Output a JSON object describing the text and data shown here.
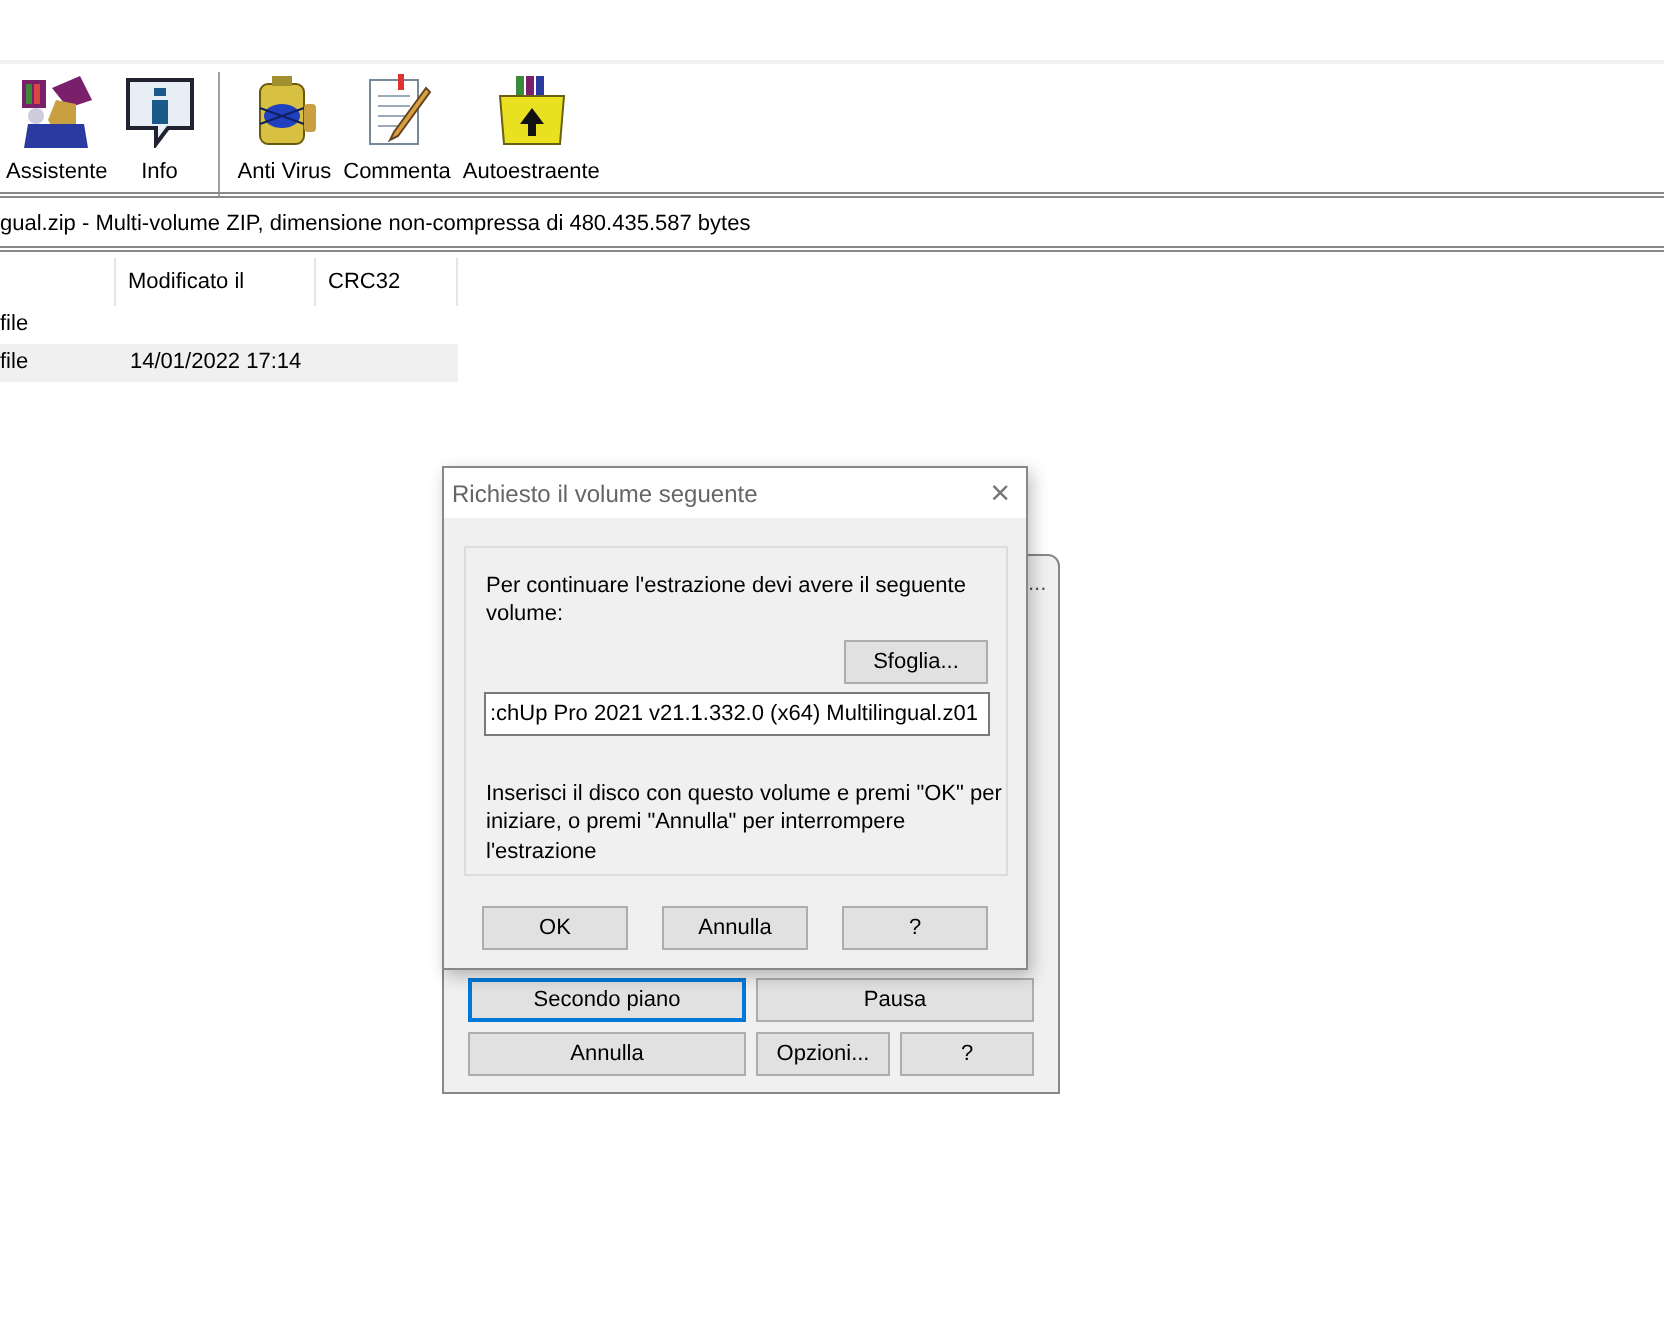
{
  "toolbar": [
    {
      "kind": "button",
      "label": "Assistente"
    },
    {
      "kind": "button",
      "label": "Info"
    },
    {
      "kind": "separator"
    },
    {
      "kind": "button",
      "label": "Anti Virus"
    },
    {
      "kind": "button",
      "label": "Commenta"
    },
    {
      "kind": "button",
      "label": "Autoestraente"
    }
  ],
  "address_bar": {
    "text": "gual.zip - Multi-volume ZIP, dimensione non-compressa di 480.435.587 bytes"
  },
  "file_list": {
    "columns": [
      "Modificato il",
      "CRC32"
    ],
    "rows": [
      {
        "name": "file",
        "selected": false
      },
      {
        "name": "file",
        "modified": "14/01/2022 17:14",
        "selected": true
      }
    ]
  },
  "back_dialog": {
    "title": "...",
    "buttons": [
      {
        "label": "Secondo piano",
        "focused": true
      },
      {
        "label": "Pausa",
        "focused": false
      },
      {
        "label": "Annulla",
        "focused": false
      },
      {
        "label": "Opzioni...",
        "focused": false
      },
      {
        "label": "?",
        "focused": false
      }
    ]
  },
  "dialog": {
    "title": "Richiesto il volume seguente",
    "close": "×",
    "message": "Per continuare l'estrazione devi avere il seguente volume:",
    "browse_button": "Sfoglia...",
    "volume": ":chUp Pro 2021 v21.1.332.0 (x64) Multilingual.z01",
    "instructions": "Inserisci il disco con questo volume e premi \"OK\" per iniziare, o premi \"Annulla\" per interrompere l'estrazione",
    "buttons": [
      "OK",
      "Annulla",
      "?"
    ]
  }
}
